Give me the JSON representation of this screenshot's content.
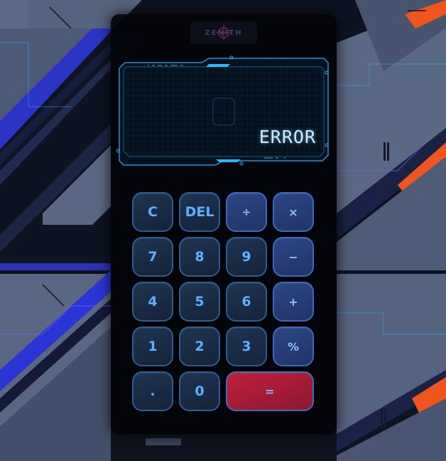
{
  "brand": {
    "logo_text": "ZENITH"
  },
  "display": {
    "value": "ERROR"
  },
  "keys": {
    "clear": "C",
    "delete": "DEL",
    "divide": "÷",
    "multiply": "×",
    "seven": "7",
    "eight": "8",
    "nine": "9",
    "minus": "−",
    "four": "4",
    "five": "5",
    "six": "6",
    "plus": "+",
    "one": "1",
    "two": "2",
    "three": "3",
    "percent": "%",
    "decimal": ".",
    "zero": "0",
    "equals": "="
  },
  "colors": {
    "key_digit": "#1a2c45",
    "key_operator": "#2a4480",
    "key_equals": "#b01d38",
    "display_glow": "#2fb6ff",
    "background_accent_orange": "#f0551e",
    "background_accent_blue": "#2a35d8"
  }
}
